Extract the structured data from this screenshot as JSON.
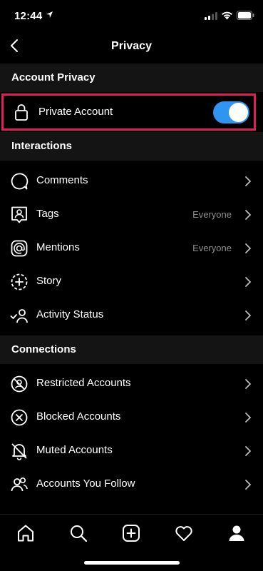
{
  "status_bar": {
    "time": "12:44"
  },
  "header": {
    "title": "Privacy"
  },
  "account_privacy": {
    "section_title": "Account Privacy",
    "private_account": {
      "label": "Private Account",
      "enabled": true
    }
  },
  "interactions": {
    "section_title": "Interactions",
    "items": [
      {
        "label": "Comments",
        "value": "",
        "icon": "comment-bubble-icon"
      },
      {
        "label": "Tags",
        "value": "Everyone",
        "icon": "tag-person-icon"
      },
      {
        "label": "Mentions",
        "value": "Everyone",
        "icon": "at-sign-icon"
      },
      {
        "label": "Story",
        "value": "",
        "icon": "story-add-icon"
      },
      {
        "label": "Activity Status",
        "value": "",
        "icon": "activity-status-icon"
      }
    ]
  },
  "connections": {
    "section_title": "Connections",
    "items": [
      {
        "label": "Restricted Accounts",
        "icon": "restricted-icon"
      },
      {
        "label": "Blocked Accounts",
        "icon": "blocked-icon"
      },
      {
        "label": "Muted Accounts",
        "icon": "muted-bell-icon"
      },
      {
        "label": "Accounts You Follow",
        "icon": "following-icon"
      }
    ]
  },
  "tab_bar": {
    "tabs": [
      "home-icon",
      "search-icon",
      "new-post-icon",
      "activity-heart-icon",
      "profile-icon"
    ],
    "active": "profile-icon"
  },
  "colors": {
    "toggle_on": "#2f95f1",
    "highlight_border": "#e01e5a",
    "secondary_text": "#8e8e8e"
  }
}
